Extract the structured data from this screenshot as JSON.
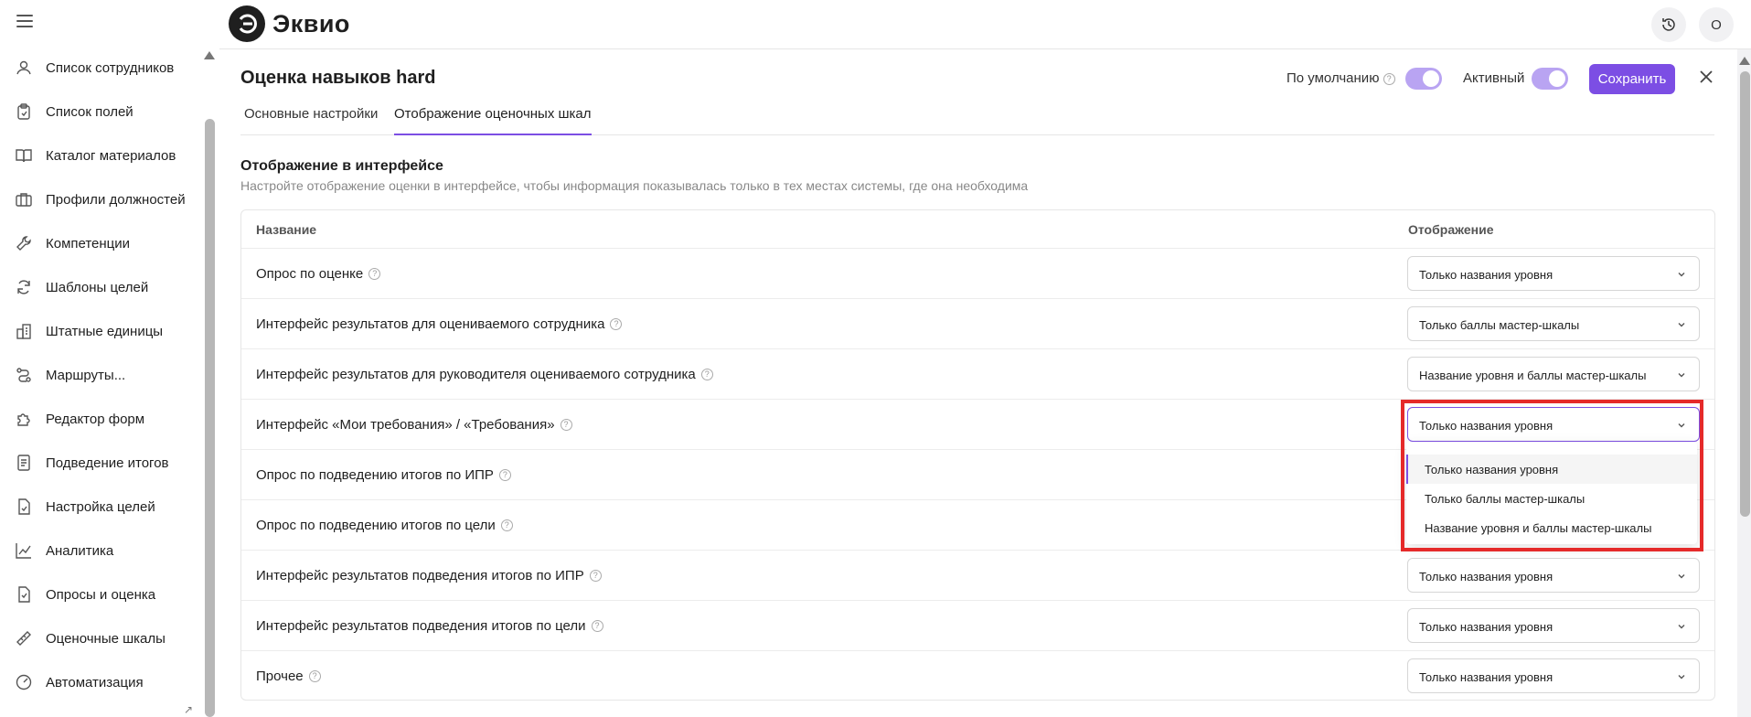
{
  "brand": {
    "name": "Эквио"
  },
  "topbar": {
    "avatar_initial": "О"
  },
  "sidebar": {
    "items": [
      {
        "label": "Список сотрудников",
        "icon": "user-icon"
      },
      {
        "label": "Список полей",
        "icon": "clipboard-icon"
      },
      {
        "label": "Каталог материалов",
        "icon": "book-icon"
      },
      {
        "label": "Профили должностей",
        "icon": "briefcase-icon"
      },
      {
        "label": "Компетенции",
        "icon": "wrench-icon"
      },
      {
        "label": "Шаблоны целей",
        "icon": "refresh-icon"
      },
      {
        "label": "Штатные единицы",
        "icon": "building-icon"
      },
      {
        "label": "Маршруты...",
        "icon": "route-icon"
      },
      {
        "label": "Редактор форм",
        "icon": "puzzle-icon"
      },
      {
        "label": "Подведение итогов",
        "icon": "document-icon"
      },
      {
        "label": "Настройка целей",
        "icon": "file-check-icon"
      },
      {
        "label": "Аналитика",
        "icon": "chart-line-icon"
      },
      {
        "label": "Опросы и оценка",
        "icon": "survey-icon"
      },
      {
        "label": "Оценочные шкалы",
        "icon": "ruler-icon"
      },
      {
        "label": "Автоматизация",
        "icon": "gauge-icon"
      }
    ]
  },
  "header": {
    "title": "Оценка навыков hard",
    "default_label": "По умолчанию",
    "active_label": "Активный",
    "save_label": "Сохранить",
    "default_on": true,
    "active_on": true
  },
  "tabs": [
    {
      "label": "Основные настройки",
      "active": false
    },
    {
      "label": "Отображение оценочных шкал",
      "active": true
    }
  ],
  "section": {
    "title": "Отображение в интерфейсе",
    "description": "Настройте отображение оценки в интерфейсе, чтобы информация показывалась только в тех местах системы, где она необходима"
  },
  "table": {
    "headers": {
      "name": "Название",
      "display": "Отображение"
    },
    "rows": [
      {
        "name": "Опрос по оценке",
        "value": "Только названия уровня"
      },
      {
        "name": "Интерфейс результатов для оцениваемого сотрудника",
        "value": "Только баллы мастер-шкалы"
      },
      {
        "name": "Интерфейс результатов для руководителя оцениваемого сотрудника",
        "value": "Название уровня и баллы мастер-шкалы"
      },
      {
        "name": "Интерфейс «Мои требования» / «Требования»",
        "value": "Только названия уровня"
      },
      {
        "name": "Опрос по подведению итогов по ИПР",
        "value": ""
      },
      {
        "name": "Опрос по подведению итогов по цели",
        "value": ""
      },
      {
        "name": "Интерфейс результатов подведения итогов по ИПР",
        "value": "Только названия уровня"
      },
      {
        "name": "Интерфейс результатов подведения итогов по цели",
        "value": "Только названия уровня"
      },
      {
        "name": "Прочее",
        "value": "Только названия уровня"
      }
    ]
  },
  "dropdown": {
    "options": [
      "Только названия уровня",
      "Только баллы мастер-шкалы",
      "Название уровня и баллы мастер-шкалы"
    ],
    "selected_index": 0
  },
  "colors": {
    "accent": "#7c4ee4",
    "highlight": "#e52a2a"
  }
}
